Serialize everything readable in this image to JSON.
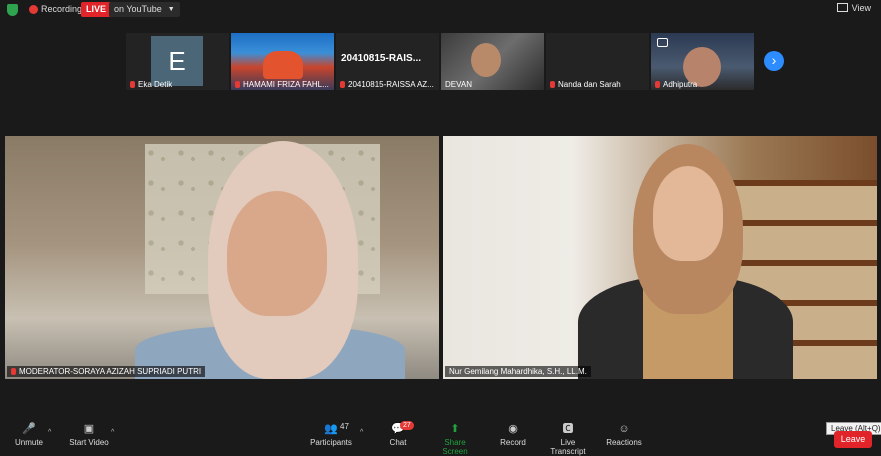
{
  "topbar": {
    "recording_label": "Recording",
    "live_label": "LIVE",
    "platform_label": "on YouTube",
    "view_label": "View"
  },
  "strip": {
    "participants": [
      {
        "name": "Eka Detik",
        "avatar_letter": "E"
      },
      {
        "name": "HAMAMI FRIZA FAHL..."
      },
      {
        "name": "20410815-RAISSA AZ...",
        "display_title": "20410815-RAIS..."
      },
      {
        "name": "DEVAN"
      },
      {
        "name": "Nanda dan Sarah"
      },
      {
        "name": "Adhiputra"
      }
    ]
  },
  "videos": {
    "left_label": "MODERATOR-SORAYA AZIZAH SUPRIADI PUTRI",
    "right_label": "Nur Gemilang Mahardhika, S.H., LL.M."
  },
  "toolbar": {
    "unmute": "Unmute",
    "start_video": "Start Video",
    "participants": "Participants",
    "participants_count": "47",
    "chat": "Chat",
    "chat_badge": "27",
    "share_screen": "Share Screen",
    "record": "Record",
    "live_transcript": "Live Transcript",
    "reactions": "Reactions",
    "leave": "Leave",
    "leave_tooltip": "Leave (Alt+Q)"
  },
  "colors": {
    "live_red": "#e0242a",
    "share_green": "#1fa23d",
    "accent_blue": "#2d8cff"
  }
}
